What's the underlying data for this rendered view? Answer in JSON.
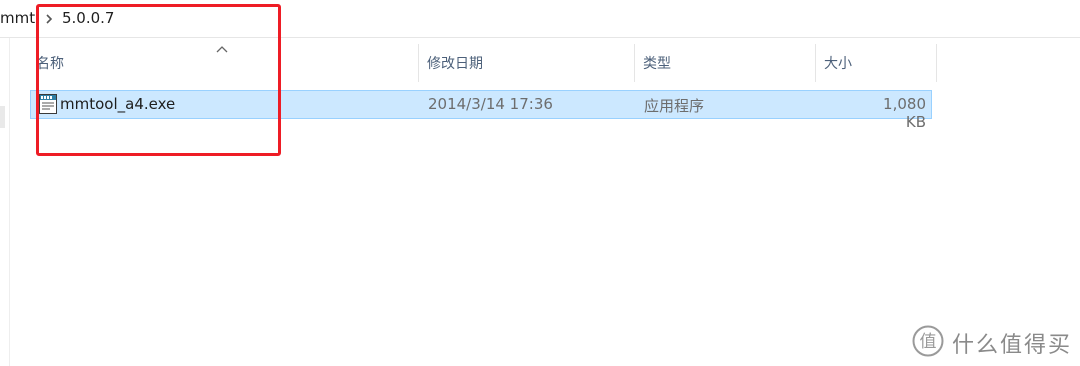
{
  "breadcrumb": {
    "items": [
      "mmt",
      "5.0.0.7"
    ]
  },
  "columns": {
    "name": "名称",
    "date_modified": "修改日期",
    "type": "类型",
    "size": "大小",
    "sort_indicator": "sort-ascending-caret-icon"
  },
  "files": [
    {
      "name": "mmtool_a4.exe",
      "date_modified": "2014/3/14 17:36",
      "type": "应用程序",
      "size": "1,080 KB",
      "icon": "executable-file-icon",
      "selected": true
    }
  ],
  "annotation": {
    "color": "#ee1c25"
  },
  "watermark": {
    "text": "什么值得买",
    "icon": "smzdm-logo-icon"
  },
  "colors": {
    "selection_fill": "#cce8ff",
    "selection_border": "#99d1ff",
    "header_text": "#4c607a"
  }
}
